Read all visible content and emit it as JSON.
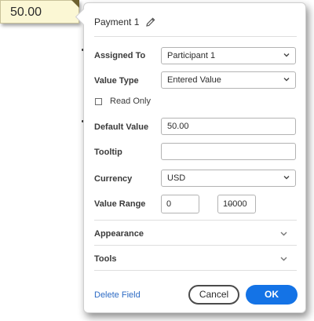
{
  "field_tag": {
    "value": "50.00"
  },
  "panel": {
    "title": "Payment 1",
    "assigned_to": {
      "label": "Assigned To",
      "value": "Participant 1"
    },
    "value_type": {
      "label": "Value Type",
      "value": "Entered Value"
    },
    "read_only": {
      "label": "Read Only",
      "checked": false
    },
    "default_value": {
      "label": "Default Value",
      "value": "50.00"
    },
    "tooltip": {
      "label": "Tooltip",
      "value": ""
    },
    "currency": {
      "label": "Currency",
      "value": "USD"
    },
    "value_range": {
      "label": "Value Range",
      "min": "0",
      "separator": "–",
      "max": "10000"
    },
    "sections": [
      {
        "label": "Appearance"
      },
      {
        "label": "Tools"
      }
    ],
    "delete_label": "Delete Field",
    "cancel_label": "Cancel",
    "ok_label": "OK",
    "colors": {
      "primary": "#1473e6",
      "link": "#2d6bc4",
      "field_bg": "#fbf7d4"
    }
  }
}
